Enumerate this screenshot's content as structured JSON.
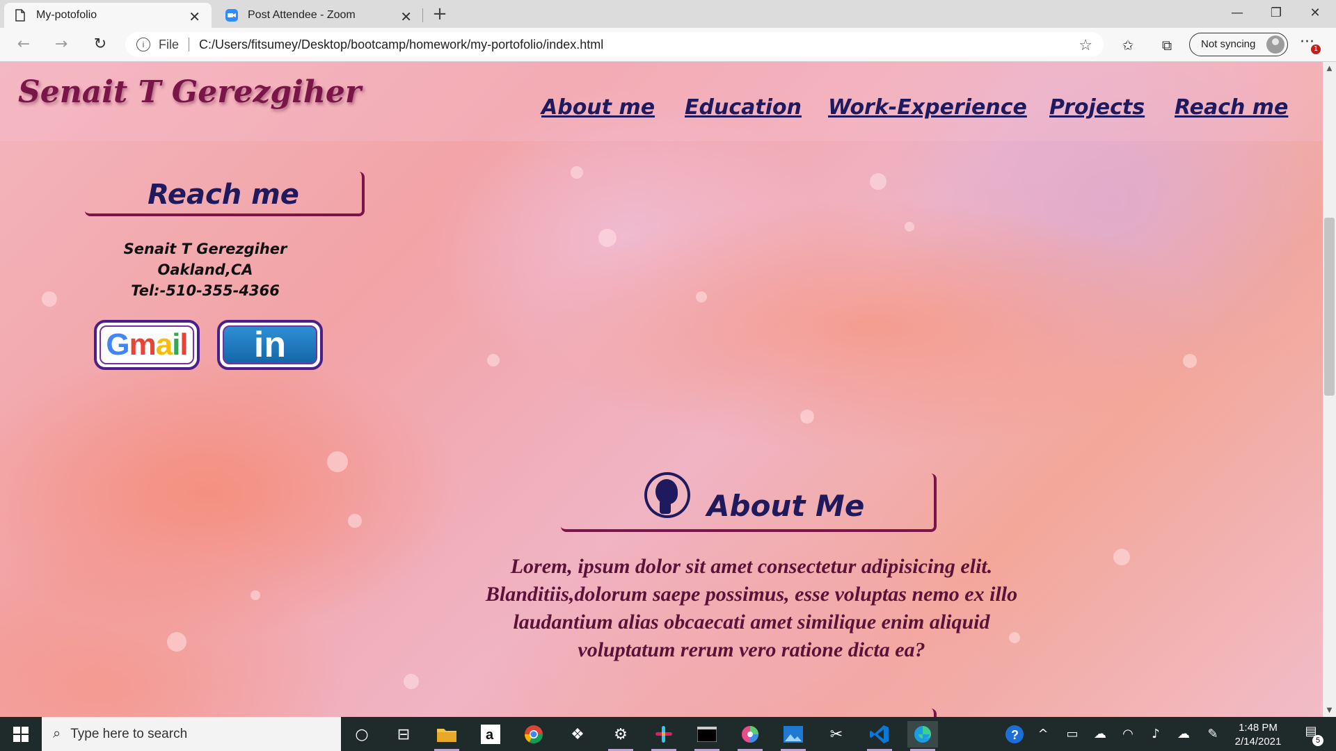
{
  "browser": {
    "tabs": [
      {
        "title": "My-potofolio",
        "active": true
      },
      {
        "title": "Post Attendee - Zoom",
        "active": false
      }
    ],
    "address": {
      "scheme_label": "File",
      "url": "C:/Users/fitsumey/Desktop/bootcamp/homework/my-portofolio/index.html"
    },
    "profile": {
      "label": "Not syncing"
    },
    "menu_badge": "1"
  },
  "site": {
    "title": "Senait T Gerezgiher",
    "nav": [
      "About me",
      "Education",
      "Work-Experience",
      "Projects",
      "Reach me"
    ],
    "reach": {
      "heading": "Reach me",
      "name": "Senait T Gerezgiher",
      "location": "Oakland,CA",
      "phone": "Tel:-510-355-4366",
      "gmail_label": "Gmail",
      "linkedin_label": "in"
    },
    "about": {
      "heading": "About Me",
      "text": "Lorem, ipsum dolor sit amet consectetur adipisicing elit. Blanditiis,dolorum saepe possimus, esse voluptas nemo ex illo laudantium alias obcaecati amet similique enim aliquid voluptatum rerum vero ratione dicta ea?"
    }
  },
  "taskbar": {
    "search_placeholder": "Type here to search",
    "time": "1:48 PM",
    "date": "2/14/2021",
    "notifications": "5"
  },
  "colors": {
    "title": "#7a1548",
    "nav": "#1f1a5e",
    "about_text": "#5a1238",
    "accent_border": "#7a1548"
  }
}
